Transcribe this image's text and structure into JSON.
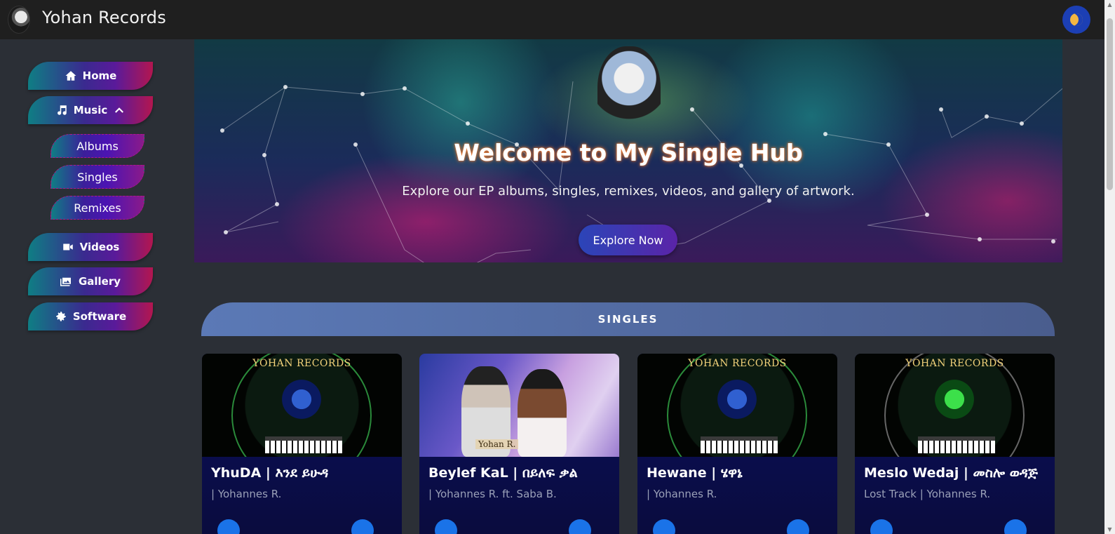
{
  "app": {
    "title": "Yohan Records",
    "logo_icon": "avatar-logo-icon",
    "theme_toggle_icon": "moon-icon"
  },
  "sidebar": {
    "items": [
      {
        "label": "Home",
        "icon": "home-icon"
      },
      {
        "label": "Music",
        "icon": "music-note-icon",
        "expanded_icon": "chevron-up-icon"
      },
      {
        "label": "Videos",
        "icon": "video-camera-icon"
      },
      {
        "label": "Gallery",
        "icon": "images-icon"
      },
      {
        "label": "Software",
        "icon": "gear-icon"
      }
    ],
    "music_submenu": [
      "Albums",
      "Singles",
      "Remixes"
    ]
  },
  "hero": {
    "title": "Welcome to My Single Hub",
    "subtitle": "Explore our EP albums, singles, remixes, videos, and gallery of artwork.",
    "cta_label": "Explore Now"
  },
  "section": {
    "title": "SINGLES"
  },
  "cards": [
    {
      "title": "YhuDA | እንደ ይሁዳ",
      "artist": "| Yohannes R.",
      "art_brand": "YOHAN RECORDS"
    },
    {
      "title": "Beylef KaL | በይለፍ ቃል",
      "artist": "| Yohannes R. ft. Saba B.",
      "art_tag": "Yohan R."
    },
    {
      "title": "Hewane | ሄዋኔ",
      "artist": "| Yohannes R.",
      "art_brand": "YOHAN RECORDS"
    },
    {
      "title": "Meslo Wedaj | መስሎ ወዳጅ",
      "artist": "Lost Track | Yohannes R.",
      "art_brand": "YOHAN RECORDS"
    }
  ],
  "colors": {
    "topbar": "#1f1f1f",
    "background": "#2b2f36",
    "accent_blue": "#1c3fb4",
    "section_header": "#5b79b6",
    "card_bg": "#0a0f5e"
  }
}
